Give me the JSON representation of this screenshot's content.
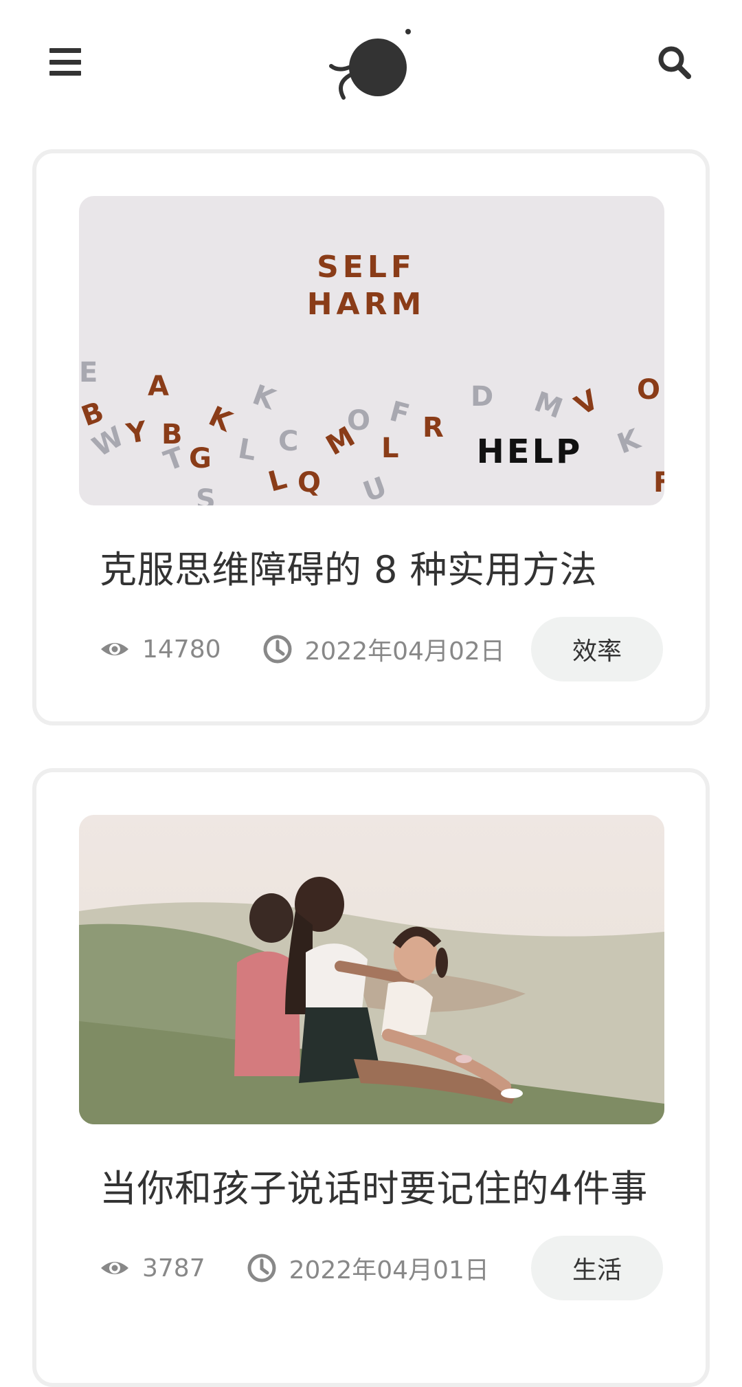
{
  "header": {
    "menu_icon": "hamburger-menu-icon",
    "logo_icon": "bird-logo-icon",
    "search_icon": "search-icon"
  },
  "posts": [
    {
      "image_text": [
        "SELF",
        "HARM",
        "HELP"
      ],
      "title": "克服思维障碍的 8 种实用方法",
      "views": "14780",
      "date": "2022年04月02日",
      "tag": "效率"
    },
    {
      "title": "当你和孩子说话时要记住的4件事",
      "views": "3787",
      "date": "2022年04月01日",
      "tag": "生活"
    }
  ],
  "colors": {
    "text": "#333333",
    "meta": "#888888",
    "tag_bg": "#f0f2f1",
    "card_border": "#eeeeee"
  }
}
